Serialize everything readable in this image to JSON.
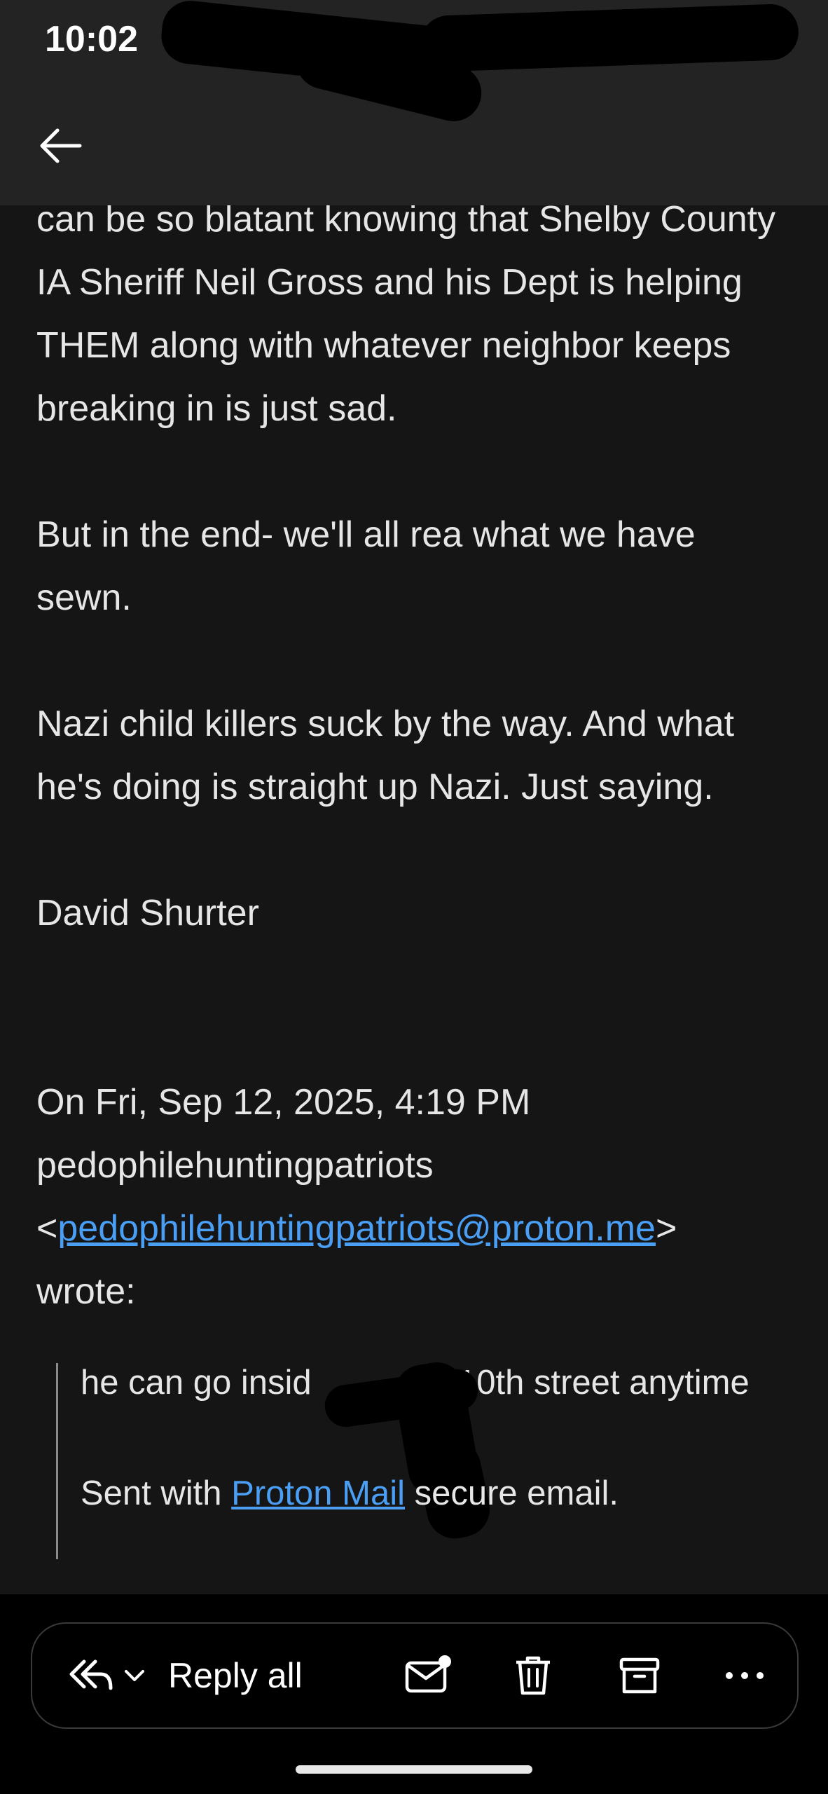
{
  "status_bar": {
    "time": "10:02"
  },
  "header": {
    "back_icon": "arrow-left-icon"
  },
  "email": {
    "paragraphs": [
      "can be so blatant knowing that Shelby County IA Sheriff Neil Gross and his Dept is helping THEM along with whatever neighbor keeps breaking in is just sad.",
      "But in the end- we'll all rea what we have sewn.",
      "Nazi child killers suck by the way. And what he's doing is straight up Nazi. Just saying.",
      "David Shurter"
    ],
    "reply_header": {
      "line1": "On Fri, Sep 12, 2025, 4:19 PM",
      "sender_name": "pedophilehuntingpatriots",
      "open_bracket": "<",
      "sender_email": "pedophilehuntingpatriots@proton.me",
      "close_bracket": ">",
      "wrote": "wrote:"
    },
    "quoted": {
      "line1_left": "he can go insid",
      "line1_right": "10th street anytime",
      "sent_prefix": "Sent with ",
      "sent_link": "Proton Mail",
      "sent_suffix": " secure email."
    }
  },
  "toolbar": {
    "reply_all_label": "Reply all",
    "icons": [
      "reply-all-icon",
      "chevron-down-icon",
      "mark-unread-icon",
      "trash-icon",
      "archive-icon",
      "more-icon"
    ]
  },
  "colors": {
    "background": "#151515",
    "header": "#232323",
    "link": "#4a9ff5",
    "text": "#e6e6e6"
  }
}
